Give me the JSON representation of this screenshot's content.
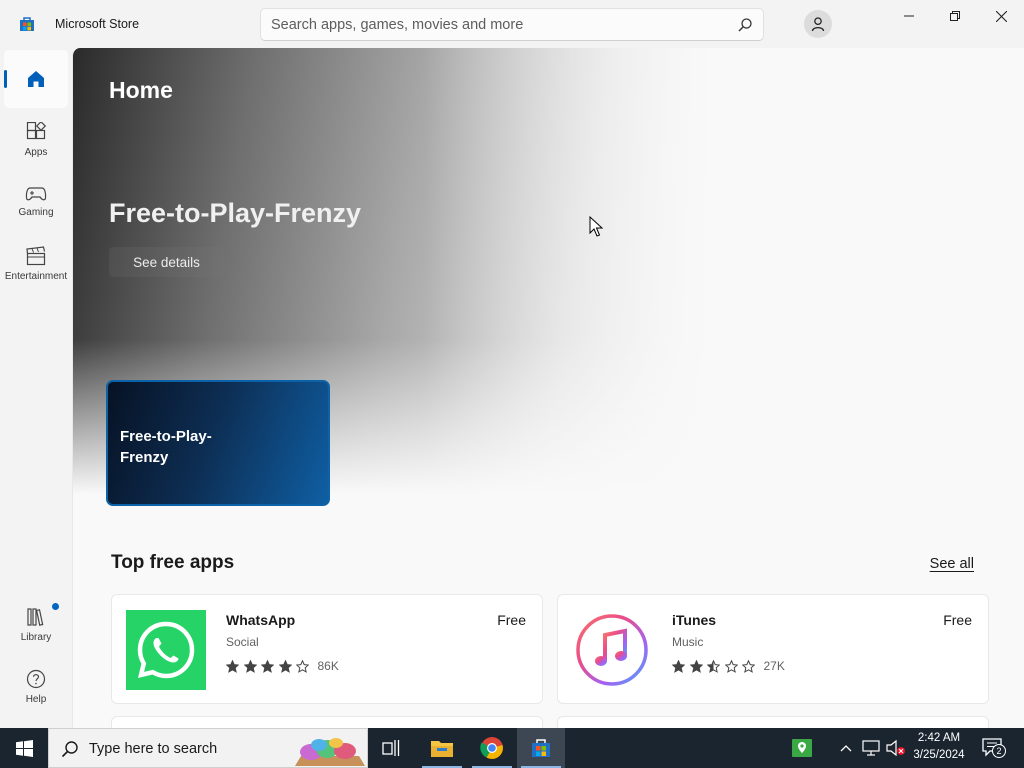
{
  "window": {
    "title": "Microsoft Store"
  },
  "search": {
    "placeholder": "Search apps, games, movies and more"
  },
  "sidebar": {
    "items": [
      {
        "label": "Home",
        "icon": "home-icon",
        "active": true
      },
      {
        "label": "Apps",
        "icon": "apps-icon"
      },
      {
        "label": "Gaming",
        "icon": "gamepad-icon"
      },
      {
        "label": "Entertainment",
        "icon": "clapperboard-icon"
      },
      {
        "label": "Library",
        "icon": "library-icon",
        "has_update_dot": true
      },
      {
        "label": "Help",
        "icon": "help-icon"
      }
    ]
  },
  "hero": {
    "page_title": "Home",
    "title": "Free-to-Play-Frenzy",
    "button_label": "See details",
    "promo_card_title": "Free-to-Play-Frenzy"
  },
  "top_free": {
    "section_title": "Top free apps",
    "see_all_label": "See all",
    "apps": [
      {
        "name": "WhatsApp",
        "category": "Social",
        "price": "Free",
        "rating": 4.0,
        "rating_count": "86K",
        "icon": "whatsapp-icon",
        "icon_color": "#25d366"
      },
      {
        "name": "iTunes",
        "category": "Music",
        "price": "Free",
        "rating": 2.5,
        "rating_count": "27K",
        "icon": "itunes-icon",
        "icon_color": "#ea4c89"
      }
    ]
  },
  "taskbar": {
    "search_placeholder": "Type here to search",
    "time": "2:42 AM",
    "date": "3/25/2024",
    "notification_count": "2",
    "pinned": [
      {
        "name": "task-view-icon"
      },
      {
        "name": "file-explorer-icon"
      },
      {
        "name": "chrome-icon"
      },
      {
        "name": "microsoft-store-icon",
        "active": true
      }
    ]
  },
  "colors": {
    "accent": "#005fb8",
    "taskbar_bg": "#1b2530",
    "promo_card": "#0b62a8"
  }
}
